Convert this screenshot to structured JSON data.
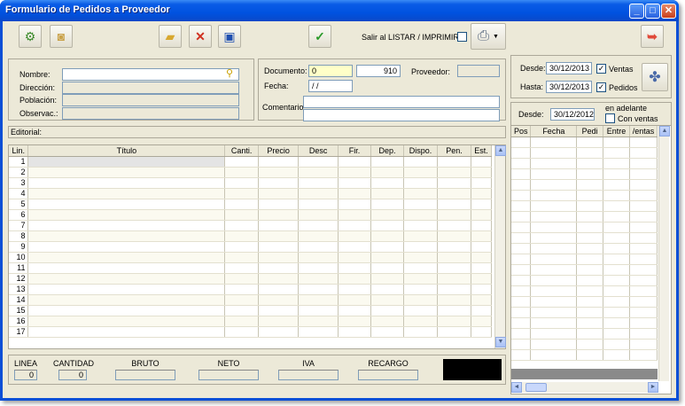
{
  "window": {
    "title": "Formulario de Pedidos a Proveedor"
  },
  "toolbar": {
    "salir_label": "Salir al LISTAR / IMPRIMIR"
  },
  "customer": {
    "nombre_label": "Nombre:",
    "direccion_label": "Dirección:",
    "poblacion_label": "Población:",
    "observac_label": "Observac.:"
  },
  "document": {
    "documento_label": "Documento:",
    "documento_value": "0",
    "documento_num": "910",
    "proveedor_label": "Proveedor:",
    "fecha_label": "Fecha:",
    "fecha_value": "/ /",
    "comentario_label": "Comentario:"
  },
  "filters": {
    "desde_label": "Desde:",
    "desde_value": "30/12/2013",
    "hasta_label": "Hasta:",
    "hasta_value": "30/12/2013",
    "ventas_label": "Ventas",
    "pedidos_label": "Pedidos"
  },
  "editorial_label": "Editorial:",
  "lines_table": {
    "columns": [
      "Lin.",
      "Título",
      "Canti.",
      "Precio",
      "Desc",
      "Fir.",
      "Dep.",
      "Dispo.",
      "Pen.",
      "Est."
    ],
    "rows": [
      "1",
      "2",
      "3",
      "4",
      "5",
      "6",
      "7",
      "8",
      "9",
      "10",
      "11",
      "12",
      "13",
      "14",
      "15",
      "16",
      "17"
    ]
  },
  "side": {
    "desde_label": "Desde:",
    "desde_value": "30/12/2012",
    "en_adelante": "en adelante",
    "con_ventas": "Con ventas",
    "columns": [
      "Pos",
      "Fecha",
      "Pedi",
      "Entre",
      "/entas"
    ]
  },
  "totals": {
    "linea_label": "LINEA",
    "linea_value": "0",
    "cantidad_label": "CANTIDAD",
    "cantidad_value": "0",
    "bruto_label": "BRUTO",
    "neto_label": "NETO",
    "iva_label": "IVA",
    "recargo_label": "RECARGO"
  }
}
